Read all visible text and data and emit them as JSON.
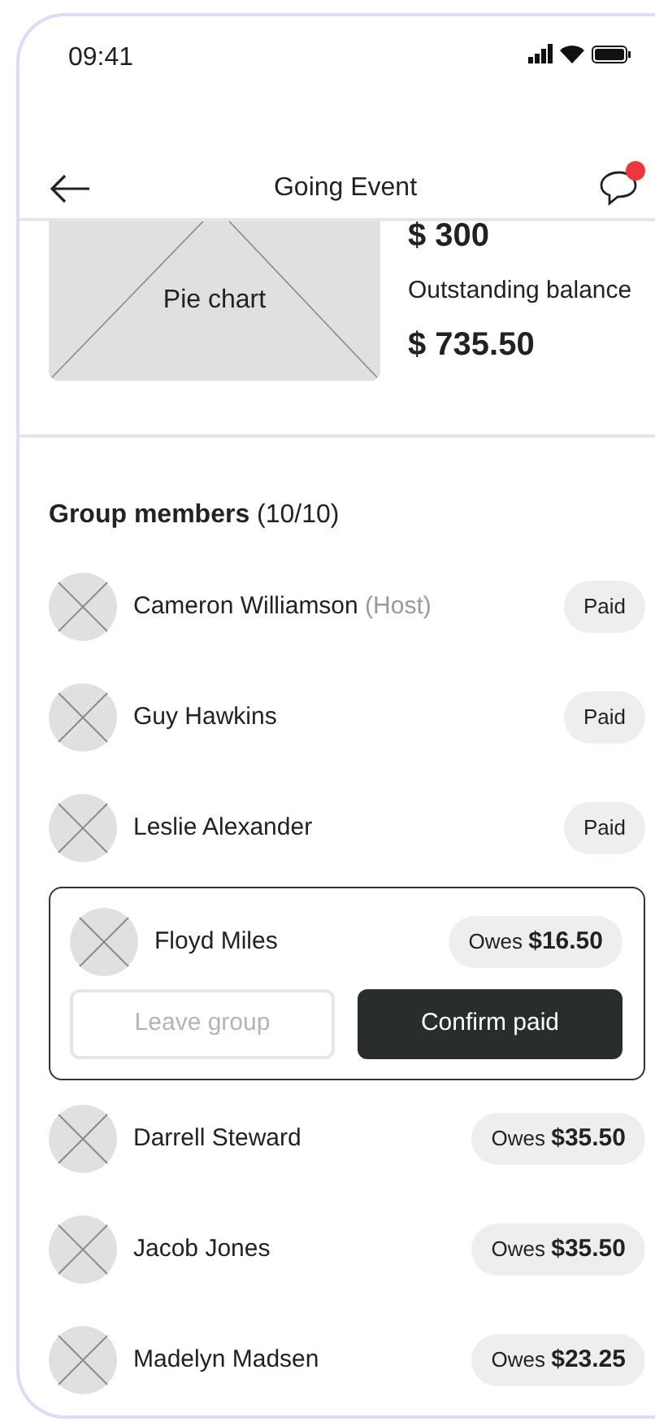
{
  "status_bar": {
    "time": "09:41"
  },
  "header": {
    "title": "Going Event",
    "chat_unread": true
  },
  "summary": {
    "chart_label": "Pie chart",
    "paid_amount": "$ 300",
    "balance_label": "Outstanding balance",
    "balance_amount": "$ 735.50"
  },
  "members_section": {
    "title": "Group members",
    "count": "(10/10)"
  },
  "members": [
    {
      "name": "Cameron Williamson",
      "role": "(Host)",
      "status": "Paid",
      "expanded": false
    },
    {
      "name": "Guy Hawkins",
      "status": "Paid",
      "expanded": false
    },
    {
      "name": "Leslie Alexander",
      "status": "Paid",
      "expanded": false
    },
    {
      "name": "Floyd Miles",
      "status": "Owes **$16.50**",
      "expanded": true,
      "actions": [
        {
          "label": "Leave group",
          "kind": "outline",
          "disabled": true
        },
        {
          "label": "Confirm paid",
          "kind": "primary",
          "disabled": false
        }
      ]
    },
    {
      "name": "Darrell Steward",
      "status": "Owes **$35.50**",
      "expanded": false
    },
    {
      "name": "Jacob Jones",
      "status": "Owes **$35.50**",
      "expanded": false
    },
    {
      "name": "Madelyn Madsen",
      "status": "Owes **$23.25**",
      "expanded": false
    }
  ]
}
